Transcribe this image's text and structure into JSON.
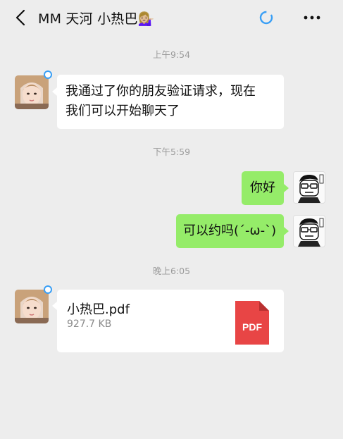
{
  "header": {
    "title": "MM  天河  小热巴💁🏼‍♀️"
  },
  "messages": {
    "ts1": "上午9:54",
    "msg1_line1": "我通过了你的朋友验证请求，现在",
    "msg1_line2": "我们可以开始聊天了",
    "ts2": "下午5:59",
    "msg2": "你好",
    "msg3": "可以约吗(´-ω-`)",
    "ts3": "晚上6:05"
  },
  "file": {
    "name": "小热巴.pdf",
    "size": "927.7 KB",
    "type_label": "PDF"
  },
  "colors": {
    "background": "#ededed",
    "sent_bubble": "#95ec69",
    "received_bubble": "#ffffff",
    "pdf_red": "#e84545",
    "accent_blue": "#3a9ff5"
  }
}
